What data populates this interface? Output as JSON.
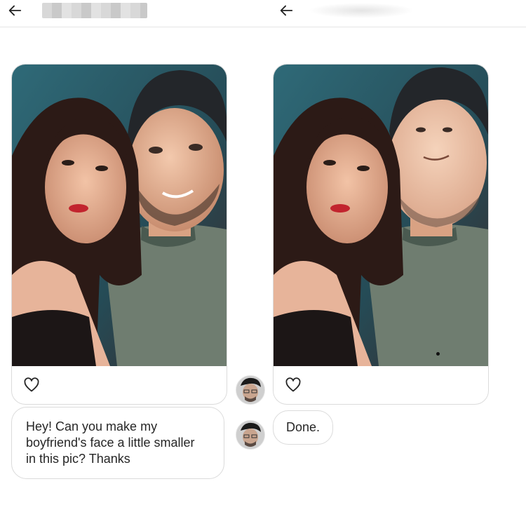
{
  "header": {
    "back_icon": "arrow-left-icon",
    "left_name": "",
    "right_name": ""
  },
  "left_post": {
    "like_icon": "heart-outline-icon",
    "photo_description_icon": "couple-selfie-photo"
  },
  "right_post": {
    "like_icon": "heart-outline-icon",
    "photo_description_icon": "edited-couple-selfie-photo"
  },
  "messages": {
    "request": "Hey! Can you make my\nboyfriend's face a little smaller\nin this pic? Thanks",
    "reply": "Done."
  },
  "colors": {
    "border": "#dbdbdb",
    "text": "#262626",
    "background": "#ffffff"
  }
}
